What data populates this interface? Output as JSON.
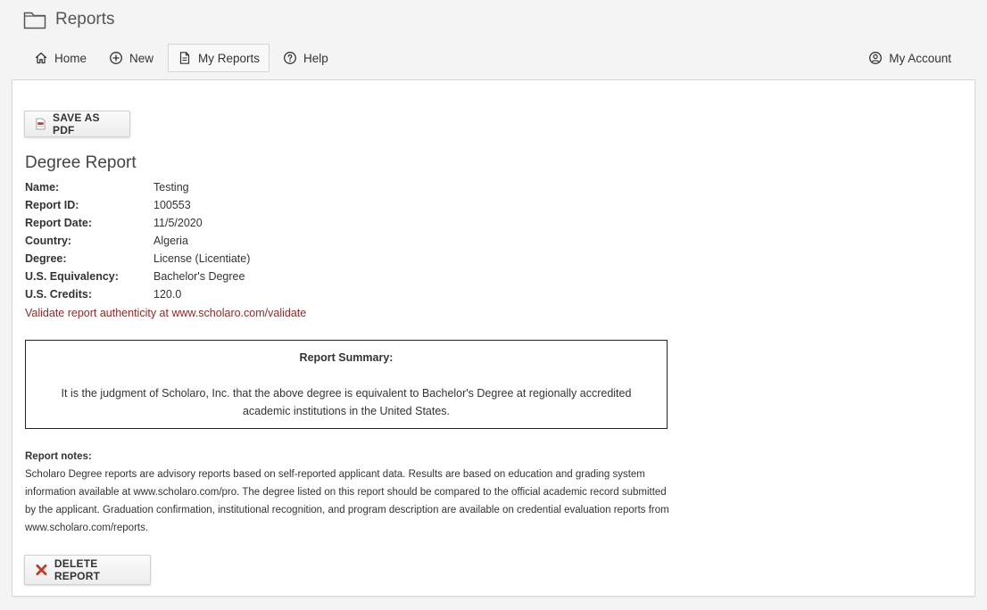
{
  "app": {
    "title": "Reports",
    "icon": "folder-icon"
  },
  "nav": {
    "home": "Home",
    "new": "New",
    "my_reports": "My Reports",
    "help": "Help",
    "my_account": "My Account",
    "active": "My Reports"
  },
  "toolbar": {
    "save_pdf_label": "SAVE AS PDF",
    "delete_label": "DELETE REPORT"
  },
  "report": {
    "title": "Degree Report",
    "fields": [
      {
        "label": "Name:",
        "value": "Testing"
      },
      {
        "label": "Report ID:",
        "value": "100553"
      },
      {
        "label": "Report Date:",
        "value": "11/5/2020"
      },
      {
        "label": "Country:",
        "value": "Algeria"
      },
      {
        "label": "Degree:",
        "value": "License (Licentiate)"
      },
      {
        "label": "U.S. Equivalency:",
        "value": "Bachelor's Degree"
      },
      {
        "label": "U.S. Credits:",
        "value": "120.0"
      }
    ],
    "validate_text": "Validate report authenticity at www.scholaro.com/validate"
  },
  "summary": {
    "heading": "Report Summary:",
    "text": "It is the judgment of Scholaro, Inc. that the above degree is equivalent to Bachelor's Degree at regionally accredited academic institutions in the United States."
  },
  "notes": {
    "heading": "Report notes:",
    "text": "Scholaro Degree reports are advisory reports based on self-reported applicant data. Results are based on education and grading system information available at www.scholaro.com/pro. The degree listed on this report should be compared to the official academic record submitted by the applicant. Graduation confirmation, institutional recognition, and program description are available on credential evaluation reports from www.scholaro.com/reports."
  },
  "colors": {
    "validate_link": "#8b2a2a",
    "delete_icon": "#c0392b",
    "pdf_icon": "#c0392b"
  }
}
